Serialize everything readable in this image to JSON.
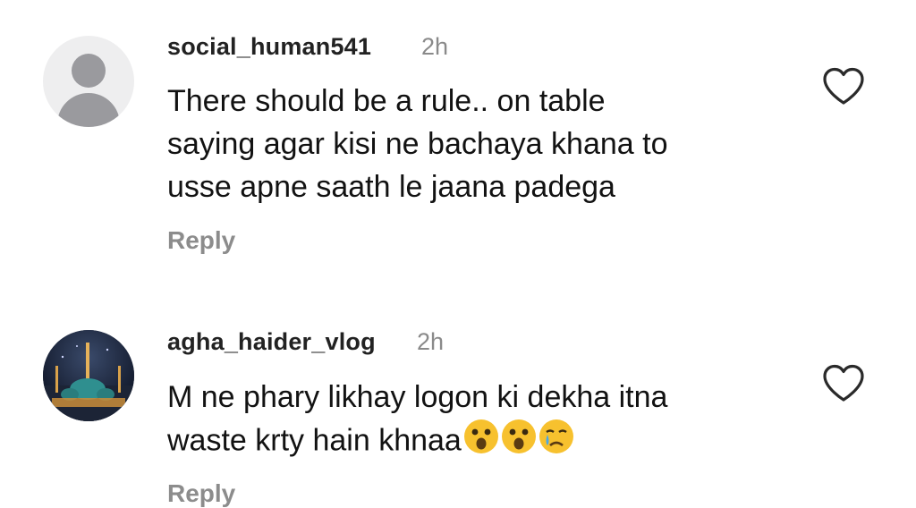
{
  "comments": [
    {
      "username": "social_human541",
      "time": "2h",
      "text_lines": [
        "There should be a rule.. on table",
        "saying agar kisi ne bachaya khana to",
        "usse apne saath le jaana padega"
      ],
      "reply_label": "Reply",
      "avatar_icon": "default-profile-icon",
      "like_icon": "heart-outline-icon"
    },
    {
      "username": "agha_haider_vlog",
      "time": "2h",
      "text_lines": [
        "M ne phary likhay logon ki dekha itna",
        "waste krty hain khnaa"
      ],
      "emojis": [
        "😮",
        "😮",
        "😢"
      ],
      "reply_label": "Reply",
      "avatar_icon": "mosque-night-photo",
      "like_icon": "heart-outline-icon"
    }
  ]
}
